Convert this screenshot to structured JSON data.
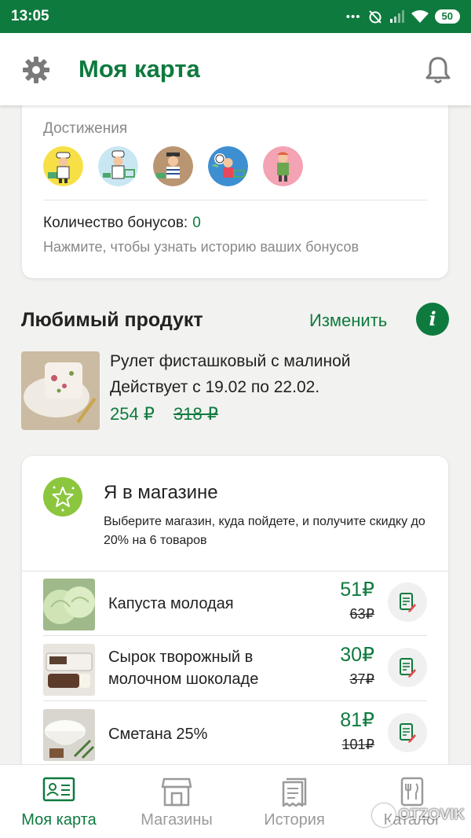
{
  "status_bar": {
    "time": "13:05",
    "battery": "50"
  },
  "app_bar": {
    "title": "Моя карта"
  },
  "achievements": {
    "title": "Достижения",
    "badges": [
      "cook-badge-icon",
      "chef-cart-badge-icon",
      "sailor-badge-icon",
      "girl-globe-badge-icon",
      "farmer-badge-icon"
    ],
    "bonus_label": "Количество бонусов:",
    "bonus_value": "0",
    "bonus_hint": "Нажмите, чтобы узнать историю ваших бонусов"
  },
  "favorite": {
    "heading": "Любимый продукт",
    "change": "Изменить",
    "info": "i",
    "name": "Рулет фисташковый с малиной",
    "valid": "Действует с 19.02 по 22.02.",
    "price": "254 ₽",
    "old_price": "318 ₽"
  },
  "store": {
    "title": "Я в магазине",
    "description": "Выберите магазин, куда пойдете, и получите скидку до 20% на 6 товаров",
    "items": [
      {
        "name": "Капуста молодая",
        "price": "51₽",
        "old_price": "63₽"
      },
      {
        "name": "Сырок творожный в молочном шоколаде",
        "price": "30₽",
        "old_price": "37₽"
      },
      {
        "name": "Сметана 25%",
        "price": "81₽",
        "old_price": "101₽"
      }
    ]
  },
  "bottom_nav": [
    {
      "label": "Моя карта",
      "icon": "id-card-icon",
      "active": true
    },
    {
      "label": "Магазины",
      "icon": "store-icon",
      "active": false
    },
    {
      "label": "История",
      "icon": "receipt-icon",
      "active": false
    },
    {
      "label": "Каталог",
      "icon": "catalog-icon",
      "active": false
    }
  ],
  "watermark": "OTZOVIK",
  "colors": {
    "brand": "#0e7a3e",
    "accent": "#8cc63f",
    "muted": "#9a9a9a"
  }
}
